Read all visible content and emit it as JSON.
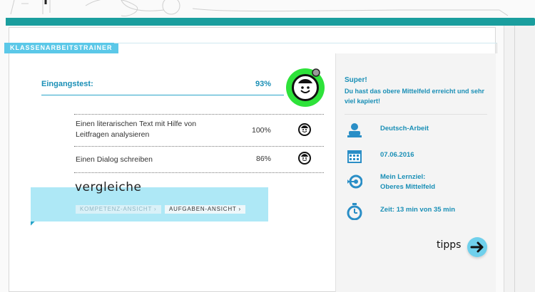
{
  "section": {
    "title": "KLASSENARBEITSTRAINER"
  },
  "entry": {
    "label": "Eingangstest:",
    "value": "93%"
  },
  "tasks": [
    {
      "name": "Einen literarischen Text mit Hilfe von Leitfragen analysieren",
      "value": "100%"
    },
    {
      "name": "Einen Dialog schreiben",
      "value": "86%"
    }
  ],
  "compare": {
    "title": "vergleiche",
    "buttons": [
      {
        "label": "KOMPETENZ-ANSICHT ›"
      },
      {
        "label": "AUFGABEN-ANSICHT ›"
      }
    ]
  },
  "feedback": {
    "headline": "Super!",
    "text": "Du hast das obere Mittelfeld erreicht und sehr viel kapiert!"
  },
  "info": {
    "subject": "Deutsch-Arbeit",
    "date": "07.06.2016",
    "goal_line1": "Mein Lernziel:",
    "goal_line2": "Oberes Mittelfeld",
    "time": "Zeit: 13 min von 35 min"
  },
  "tipps": {
    "label": "tipps"
  },
  "colors": {
    "accent": "#1a8fb6",
    "teal": "#1a9e9e",
    "badge": "#2ee23a",
    "compare_bg": "#aee8f6"
  }
}
